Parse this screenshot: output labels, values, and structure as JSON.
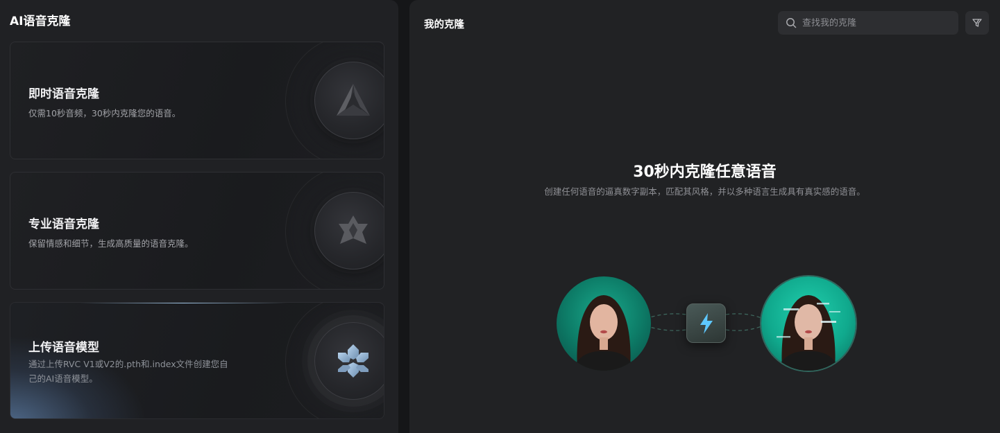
{
  "left": {
    "title": "AI语音克隆",
    "cards": [
      {
        "title": "即时语音克隆",
        "desc": "仅需10秒音频，30秒内克隆您的语音。",
        "icon": "triangle-logo-icon"
      },
      {
        "title": "专业语音克隆",
        "desc": "保留情感和细节，生成高质量的语音克隆。",
        "icon": "star-logo-icon"
      },
      {
        "title": "上传语音模型",
        "desc": "通过上传RVC V1或V2的.pth和.index文件创建您自己的AI语音模型。",
        "icon": "snowflake-logo-icon"
      }
    ]
  },
  "right": {
    "title": "我的克隆",
    "search": {
      "placeholder": "查找我的克隆",
      "value": ""
    },
    "hero": {
      "title": "30秒内克隆任意语音",
      "subtitle": "创建任何语音的逼真数字副本，匹配其风格，并以多种语言生成具有真实感的语音。"
    }
  },
  "colors": {
    "accent_teal": "#14b896",
    "bolt": "#5ec8ff",
    "panel_bg": "#212224"
  }
}
